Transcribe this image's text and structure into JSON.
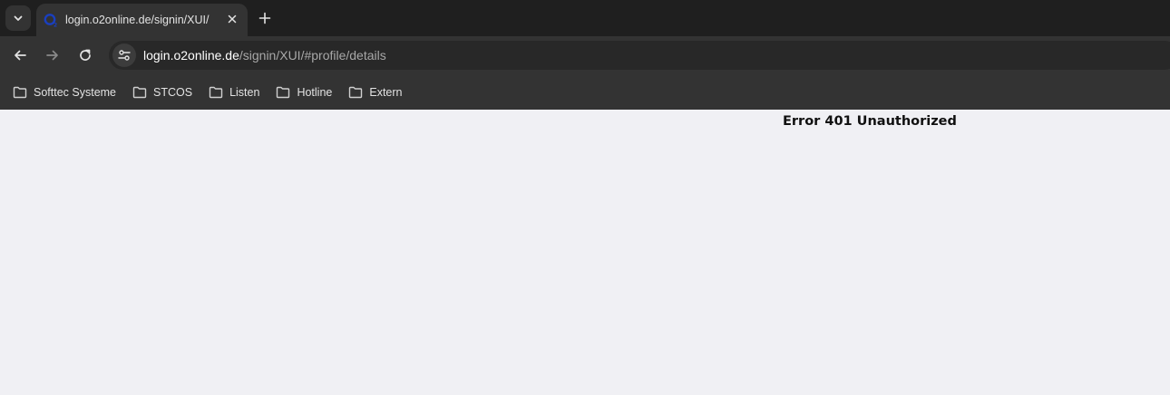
{
  "tab": {
    "title": "login.o2online.de/signin/XUI/",
    "favicon": "o2-logo-icon"
  },
  "toolbar": {
    "url_host": "login.o2online.de",
    "url_path": "/signin/XUI/#profile/details"
  },
  "bookmarks": [
    {
      "label": "Softtec Systeme",
      "icon": "folder-icon"
    },
    {
      "label": "STCOS",
      "icon": "folder-icon"
    },
    {
      "label": "Listen",
      "icon": "folder-icon"
    },
    {
      "label": "Hotline",
      "icon": "folder-icon"
    },
    {
      "label": "Extern",
      "icon": "folder-icon"
    }
  ],
  "page": {
    "error_text": "Error 401 Unauthorized"
  },
  "colors": {
    "tabstrip_bg": "#1f1f1f",
    "toolbar_bg": "#333333",
    "page_bg": "#f0f0f4",
    "favicon_blue": "#0019a5"
  }
}
